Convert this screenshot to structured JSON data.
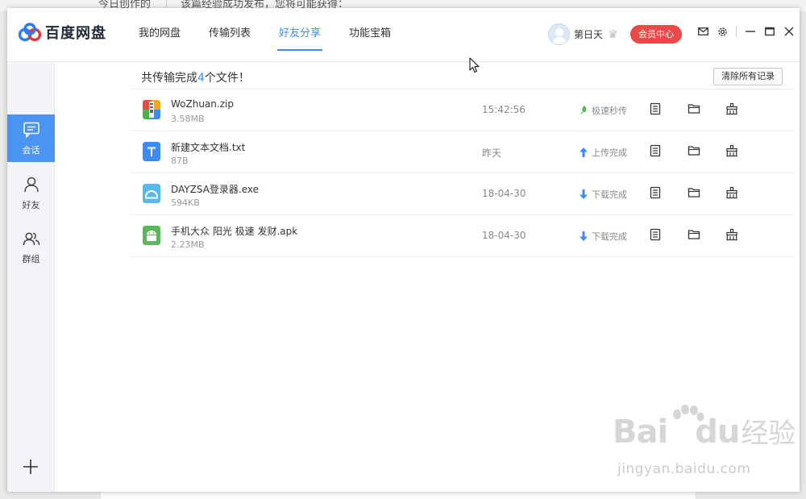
{
  "background": {
    "left_text": "今日创作的",
    "right_text": "该篇经验成功发布，您将可能获得："
  },
  "app": {
    "name": "百度网盘",
    "brand_color": "#3c8cf2"
  },
  "nav": {
    "tabs": [
      {
        "label": "我的网盘",
        "active": false
      },
      {
        "label": "传输列表",
        "active": false
      },
      {
        "label": "好友分享",
        "active": true
      },
      {
        "label": "功能宝箱",
        "active": false
      }
    ]
  },
  "user": {
    "name": "第日天",
    "vip_label": "会员中心"
  },
  "sidebar": {
    "items": [
      {
        "label": "会话",
        "icon": "chat-icon",
        "active": true
      },
      {
        "label": "好友",
        "icon": "person-icon",
        "active": false
      },
      {
        "label": "群组",
        "icon": "group-icon",
        "active": false
      }
    ]
  },
  "content": {
    "summary_prefix": "共传输完成",
    "summary_count": "4",
    "summary_suffix": "个文件！",
    "clear_label": "清除所有记录"
  },
  "files": [
    {
      "name": "WoZhuan.zip",
      "size": "3.58MB",
      "time": "15:42:56",
      "status": "极速秒传",
      "status_icon": "rocket-icon",
      "file_icon": "zip-icon"
    },
    {
      "name": "新建文本文档.txt",
      "size": "87B",
      "time": "昨天",
      "status": "上传完成",
      "status_icon": "arrow-up-icon",
      "file_icon": "txt-icon"
    },
    {
      "name": "DAYZSA登录器.exe",
      "size": "594KB",
      "time": "18-04-30",
      "status": "下载完成",
      "status_icon": "arrow-down-icon",
      "file_icon": "exe-icon"
    },
    {
      "name": "手机大众 阳光 极速 发财.apk",
      "size": "2.23MB",
      "time": "18-04-30",
      "status": "下载完成",
      "status_icon": "arrow-down-icon",
      "file_icon": "apk-icon"
    }
  ],
  "watermark": {
    "brand": "Bai",
    "brand2": "du",
    "cn": "经验",
    "url": "jingyan.baidu.com"
  }
}
